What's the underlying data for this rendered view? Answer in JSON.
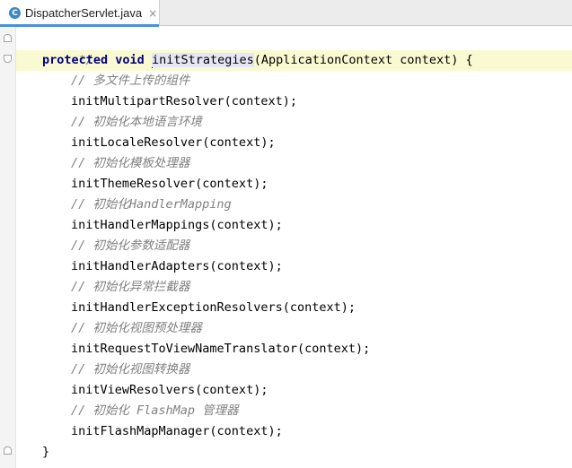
{
  "tab": {
    "icon": "C",
    "filename": "DispatcherServlet.java",
    "close": "×"
  },
  "code": {
    "l0": "*/",
    "l1_kw1": "protected",
    "l1_kw2": "void",
    "l1_method": "initStrategies",
    "l1_rest": "(ApplicationContext context) {",
    "lines": [
      {
        "text": "// 多文件上传的组件",
        "comment": true
      },
      {
        "text": "initMultipartResolver(context);",
        "comment": false
      },
      {
        "text": "// 初始化本地语言环境",
        "comment": true
      },
      {
        "text": "initLocaleResolver(context);",
        "comment": false
      },
      {
        "text": "// 初始化模板处理器",
        "comment": true
      },
      {
        "text": "initThemeResolver(context);",
        "comment": false
      },
      {
        "text": "// 初始化HandlerMapping",
        "comment": true
      },
      {
        "text": "initHandlerMappings(context);",
        "comment": false
      },
      {
        "text": "// 初始化参数适配器",
        "comment": true
      },
      {
        "text": "initHandlerAdapters(context);",
        "comment": false
      },
      {
        "text": "// 初始化异常拦截器",
        "comment": true
      },
      {
        "text": "initHandlerExceptionResolvers(context);",
        "comment": false
      },
      {
        "text": "// 初始化视图预处理器",
        "comment": true
      },
      {
        "text": "initRequestToViewNameTranslator(context);",
        "comment": false
      },
      {
        "text": "// 初始化视图转换器",
        "comment": true
      },
      {
        "text": "initViewResolvers(context);",
        "comment": false
      },
      {
        "text": "// 初始化 FlashMap 管理器",
        "comment": true
      },
      {
        "text": "initFlashMapManager(context);",
        "comment": false
      }
    ],
    "closing": "}"
  }
}
